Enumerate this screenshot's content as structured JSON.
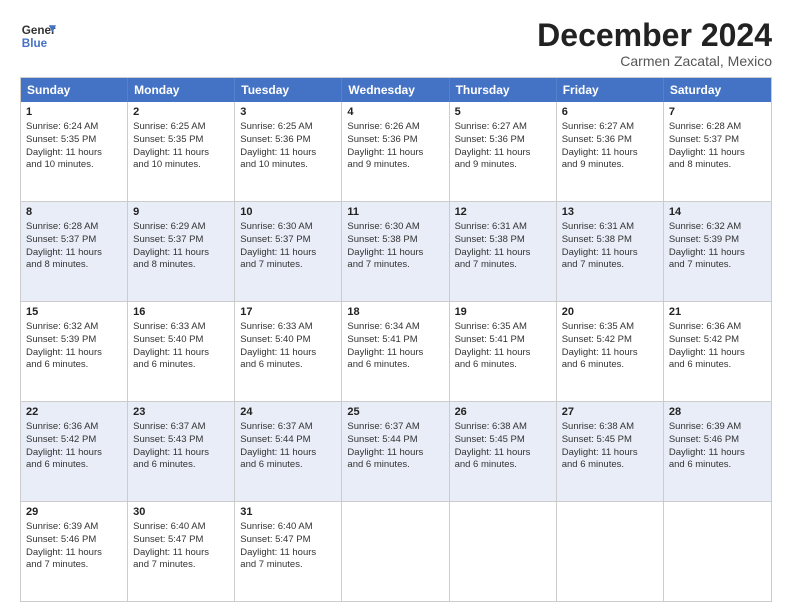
{
  "header": {
    "logo_line1": "General",
    "logo_line2": "Blue",
    "month": "December 2024",
    "location": "Carmen Zacatal, Mexico"
  },
  "days_of_week": [
    "Sunday",
    "Monday",
    "Tuesday",
    "Wednesday",
    "Thursday",
    "Friday",
    "Saturday"
  ],
  "rows": [
    [
      {
        "day": "1",
        "line1": "Sunrise: 6:24 AM",
        "line2": "Sunset: 5:35 PM",
        "line3": "Daylight: 11 hours",
        "line4": "and 10 minutes."
      },
      {
        "day": "2",
        "line1": "Sunrise: 6:25 AM",
        "line2": "Sunset: 5:35 PM",
        "line3": "Daylight: 11 hours",
        "line4": "and 10 minutes."
      },
      {
        "day": "3",
        "line1": "Sunrise: 6:25 AM",
        "line2": "Sunset: 5:36 PM",
        "line3": "Daylight: 11 hours",
        "line4": "and 10 minutes."
      },
      {
        "day": "4",
        "line1": "Sunrise: 6:26 AM",
        "line2": "Sunset: 5:36 PM",
        "line3": "Daylight: 11 hours",
        "line4": "and 9 minutes."
      },
      {
        "day": "5",
        "line1": "Sunrise: 6:27 AM",
        "line2": "Sunset: 5:36 PM",
        "line3": "Daylight: 11 hours",
        "line4": "and 9 minutes."
      },
      {
        "day": "6",
        "line1": "Sunrise: 6:27 AM",
        "line2": "Sunset: 5:36 PM",
        "line3": "Daylight: 11 hours",
        "line4": "and 9 minutes."
      },
      {
        "day": "7",
        "line1": "Sunrise: 6:28 AM",
        "line2": "Sunset: 5:37 PM",
        "line3": "Daylight: 11 hours",
        "line4": "and 8 minutes."
      }
    ],
    [
      {
        "day": "8",
        "line1": "Sunrise: 6:28 AM",
        "line2": "Sunset: 5:37 PM",
        "line3": "Daylight: 11 hours",
        "line4": "and 8 minutes."
      },
      {
        "day": "9",
        "line1": "Sunrise: 6:29 AM",
        "line2": "Sunset: 5:37 PM",
        "line3": "Daylight: 11 hours",
        "line4": "and 8 minutes."
      },
      {
        "day": "10",
        "line1": "Sunrise: 6:30 AM",
        "line2": "Sunset: 5:37 PM",
        "line3": "Daylight: 11 hours",
        "line4": "and 7 minutes."
      },
      {
        "day": "11",
        "line1": "Sunrise: 6:30 AM",
        "line2": "Sunset: 5:38 PM",
        "line3": "Daylight: 11 hours",
        "line4": "and 7 minutes."
      },
      {
        "day": "12",
        "line1": "Sunrise: 6:31 AM",
        "line2": "Sunset: 5:38 PM",
        "line3": "Daylight: 11 hours",
        "line4": "and 7 minutes."
      },
      {
        "day": "13",
        "line1": "Sunrise: 6:31 AM",
        "line2": "Sunset: 5:38 PM",
        "line3": "Daylight: 11 hours",
        "line4": "and 7 minutes."
      },
      {
        "day": "14",
        "line1": "Sunrise: 6:32 AM",
        "line2": "Sunset: 5:39 PM",
        "line3": "Daylight: 11 hours",
        "line4": "and 7 minutes."
      }
    ],
    [
      {
        "day": "15",
        "line1": "Sunrise: 6:32 AM",
        "line2": "Sunset: 5:39 PM",
        "line3": "Daylight: 11 hours",
        "line4": "and 6 minutes."
      },
      {
        "day": "16",
        "line1": "Sunrise: 6:33 AM",
        "line2": "Sunset: 5:40 PM",
        "line3": "Daylight: 11 hours",
        "line4": "and 6 minutes."
      },
      {
        "day": "17",
        "line1": "Sunrise: 6:33 AM",
        "line2": "Sunset: 5:40 PM",
        "line3": "Daylight: 11 hours",
        "line4": "and 6 minutes."
      },
      {
        "day": "18",
        "line1": "Sunrise: 6:34 AM",
        "line2": "Sunset: 5:41 PM",
        "line3": "Daylight: 11 hours",
        "line4": "and 6 minutes."
      },
      {
        "day": "19",
        "line1": "Sunrise: 6:35 AM",
        "line2": "Sunset: 5:41 PM",
        "line3": "Daylight: 11 hours",
        "line4": "and 6 minutes."
      },
      {
        "day": "20",
        "line1": "Sunrise: 6:35 AM",
        "line2": "Sunset: 5:42 PM",
        "line3": "Daylight: 11 hours",
        "line4": "and 6 minutes."
      },
      {
        "day": "21",
        "line1": "Sunrise: 6:36 AM",
        "line2": "Sunset: 5:42 PM",
        "line3": "Daylight: 11 hours",
        "line4": "and 6 minutes."
      }
    ],
    [
      {
        "day": "22",
        "line1": "Sunrise: 6:36 AM",
        "line2": "Sunset: 5:42 PM",
        "line3": "Daylight: 11 hours",
        "line4": "and 6 minutes."
      },
      {
        "day": "23",
        "line1": "Sunrise: 6:37 AM",
        "line2": "Sunset: 5:43 PM",
        "line3": "Daylight: 11 hours",
        "line4": "and 6 minutes."
      },
      {
        "day": "24",
        "line1": "Sunrise: 6:37 AM",
        "line2": "Sunset: 5:44 PM",
        "line3": "Daylight: 11 hours",
        "line4": "and 6 minutes."
      },
      {
        "day": "25",
        "line1": "Sunrise: 6:37 AM",
        "line2": "Sunset: 5:44 PM",
        "line3": "Daylight: 11 hours",
        "line4": "and 6 minutes."
      },
      {
        "day": "26",
        "line1": "Sunrise: 6:38 AM",
        "line2": "Sunset: 5:45 PM",
        "line3": "Daylight: 11 hours",
        "line4": "and 6 minutes."
      },
      {
        "day": "27",
        "line1": "Sunrise: 6:38 AM",
        "line2": "Sunset: 5:45 PM",
        "line3": "Daylight: 11 hours",
        "line4": "and 6 minutes."
      },
      {
        "day": "28",
        "line1": "Sunrise: 6:39 AM",
        "line2": "Sunset: 5:46 PM",
        "line3": "Daylight: 11 hours",
        "line4": "and 6 minutes."
      }
    ],
    [
      {
        "day": "29",
        "line1": "Sunrise: 6:39 AM",
        "line2": "Sunset: 5:46 PM",
        "line3": "Daylight: 11 hours",
        "line4": "and 7 minutes."
      },
      {
        "day": "30",
        "line1": "Sunrise: 6:40 AM",
        "line2": "Sunset: 5:47 PM",
        "line3": "Daylight: 11 hours",
        "line4": "and 7 minutes."
      },
      {
        "day": "31",
        "line1": "Sunrise: 6:40 AM",
        "line2": "Sunset: 5:47 PM",
        "line3": "Daylight: 11 hours",
        "line4": "and 7 minutes."
      },
      null,
      null,
      null,
      null
    ]
  ]
}
